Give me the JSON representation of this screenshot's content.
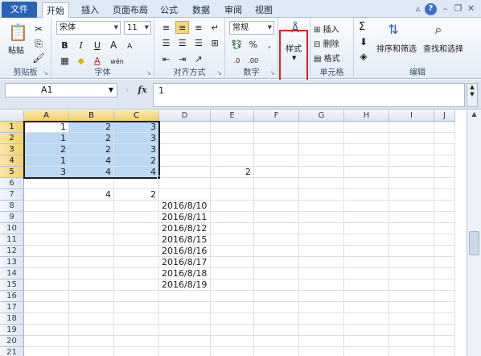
{
  "tabs": [
    {
      "label": "文件"
    },
    {
      "label": "开始"
    },
    {
      "label": "插入"
    },
    {
      "label": "页面布局"
    },
    {
      "label": "公式"
    },
    {
      "label": "数据"
    },
    {
      "label": "审阅"
    },
    {
      "label": "视图"
    }
  ],
  "ribbon": {
    "clipboard": {
      "label": "剪贴板",
      "paste": "粘贴"
    },
    "font": {
      "label": "字体",
      "name": "宋体",
      "size": "11",
      "bold": "B",
      "italic": "I",
      "underline": "U",
      "grow": "A",
      "shrink": "A",
      "color_glyph": "A",
      "phonetic": "wén"
    },
    "alignment": {
      "label": "对齐方式"
    },
    "number": {
      "label": "数字",
      "format": "常规",
      "percent": "%",
      "comma": ","
    },
    "styles": {
      "label": "样式",
      "style_btn": "样式"
    },
    "cells": {
      "label": "单元格",
      "insert": "插入",
      "delete": "删除",
      "format": "格式"
    },
    "editing": {
      "label": "编辑",
      "sum": "Σ",
      "sort": "排序和筛选",
      "find": "查找和选择"
    }
  },
  "formula_bar": {
    "name_box": "A1",
    "fx": "fx",
    "content": "1"
  },
  "columns": [
    "A",
    "B",
    "C",
    "D",
    "E",
    "F",
    "G",
    "H",
    "I",
    "J"
  ],
  "rows": [
    "1",
    "2",
    "3",
    "4",
    "5",
    "6",
    "7",
    "8",
    "9",
    "10",
    "11",
    "12",
    "13",
    "14",
    "15",
    "16",
    "17",
    "18",
    "19",
    "20",
    "21"
  ],
  "cells": [
    {
      "col": 0,
      "row": 0,
      "v": "1",
      "type": "num"
    },
    {
      "col": 1,
      "row": 0,
      "v": "2",
      "type": "num"
    },
    {
      "col": 2,
      "row": 0,
      "v": "3",
      "type": "num"
    },
    {
      "col": 0,
      "row": 1,
      "v": "1",
      "type": "num"
    },
    {
      "col": 1,
      "row": 1,
      "v": "2",
      "type": "num"
    },
    {
      "col": 2,
      "row": 1,
      "v": "3",
      "type": "num"
    },
    {
      "col": 0,
      "row": 2,
      "v": "2",
      "type": "num"
    },
    {
      "col": 1,
      "row": 2,
      "v": "2",
      "type": "num"
    },
    {
      "col": 2,
      "row": 2,
      "v": "3",
      "type": "num"
    },
    {
      "col": 0,
      "row": 3,
      "v": "1",
      "type": "num"
    },
    {
      "col": 1,
      "row": 3,
      "v": "4",
      "type": "num"
    },
    {
      "col": 2,
      "row": 3,
      "v": "2",
      "type": "num"
    },
    {
      "col": 0,
      "row": 4,
      "v": "3",
      "type": "num"
    },
    {
      "col": 1,
      "row": 4,
      "v": "4",
      "type": "num"
    },
    {
      "col": 2,
      "row": 4,
      "v": "4",
      "type": "num"
    },
    {
      "col": 4,
      "row": 4,
      "v": "2",
      "type": "num"
    },
    {
      "col": 1,
      "row": 6,
      "v": "4",
      "type": "num"
    },
    {
      "col": 2,
      "row": 6,
      "v": "2",
      "type": "num"
    },
    {
      "col": 3,
      "row": 7,
      "v": "2016/8/10",
      "type": "date"
    },
    {
      "col": 3,
      "row": 8,
      "v": "2016/8/11",
      "type": "date"
    },
    {
      "col": 3,
      "row": 9,
      "v": "2016/8/12",
      "type": "date"
    },
    {
      "col": 3,
      "row": 10,
      "v": "2016/8/15",
      "type": "date"
    },
    {
      "col": 3,
      "row": 11,
      "v": "2016/8/16",
      "type": "date"
    },
    {
      "col": 3,
      "row": 12,
      "v": "2016/8/17",
      "type": "date"
    },
    {
      "col": 3,
      "row": 13,
      "v": "2016/8/18",
      "type": "date"
    },
    {
      "col": 3,
      "row": 14,
      "v": "2016/8/19",
      "type": "date"
    }
  ],
  "selection": {
    "range": "A1:C5"
  },
  "colors": {
    "accent": "#2a62b8",
    "selection": "#bcd8f3",
    "header_selected": "#f6cf6c",
    "highlight_box": "#d42424"
  }
}
